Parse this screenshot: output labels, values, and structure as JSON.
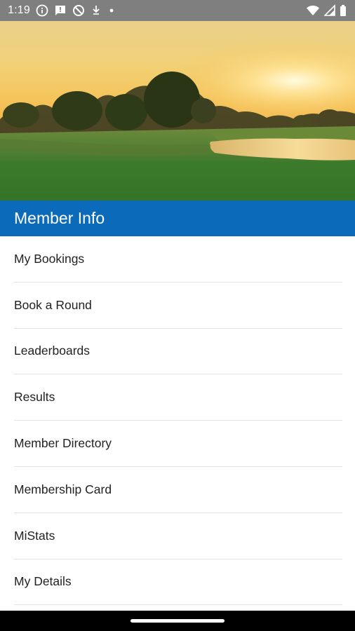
{
  "status_bar": {
    "time": "1:19",
    "icons": [
      "info-icon",
      "message-icon",
      "blocked-icon",
      "download-icon",
      "dot-icon",
      "wifi-icon",
      "signal-icon",
      "battery-icon"
    ]
  },
  "hero": {
    "image": "golf-course-sunset"
  },
  "section": {
    "title": "Member Info"
  },
  "menu": {
    "items": [
      {
        "label": "My Bookings"
      },
      {
        "label": "Book a Round"
      },
      {
        "label": "Leaderboards"
      },
      {
        "label": "Results"
      },
      {
        "label": "Member Directory"
      },
      {
        "label": "Membership Card"
      },
      {
        "label": "MiStats"
      },
      {
        "label": "My Details"
      }
    ]
  },
  "colors": {
    "header_blue": "#0b6ab9",
    "status_gray": "#7f7f7f",
    "divider": "#e3e3e3",
    "text": "#222222"
  }
}
